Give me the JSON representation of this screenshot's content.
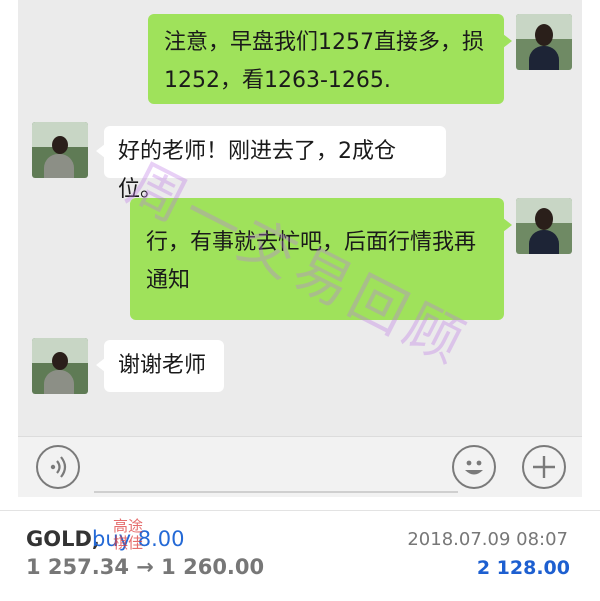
{
  "messages": [
    {
      "side": "right",
      "text_line1": "注意，早盘我们1257直接多，损",
      "text_line2": "1252，看1263-1265."
    },
    {
      "side": "left",
      "text": "好的老师！刚进去了，2成仓位。"
    },
    {
      "side": "right",
      "text_line1": "行，有事就去忙吧，后面行情我再",
      "text_line2": "通知"
    },
    {
      "side": "left",
      "text": "谢谢老师"
    }
  ],
  "watermark": "周一交易回顾",
  "toolbar": {
    "voice_icon": "voice-icon",
    "emoji_icon": "emoji-icon",
    "plus_icon": "plus-icon"
  },
  "trade": {
    "symbol": "GOLD,",
    "action": "buy 8.00",
    "prices": "1 257.34 → 1 260.00",
    "datetime": "2018.07.09 08:07",
    "profit": "2 128.00"
  },
  "stamp": "高途\n棋佳",
  "colors": {
    "right_bubble": "#9fe25b",
    "left_bubble": "#ffffff",
    "chat_bg": "#ebebeb",
    "profit_blue": "#1d5fd0"
  }
}
